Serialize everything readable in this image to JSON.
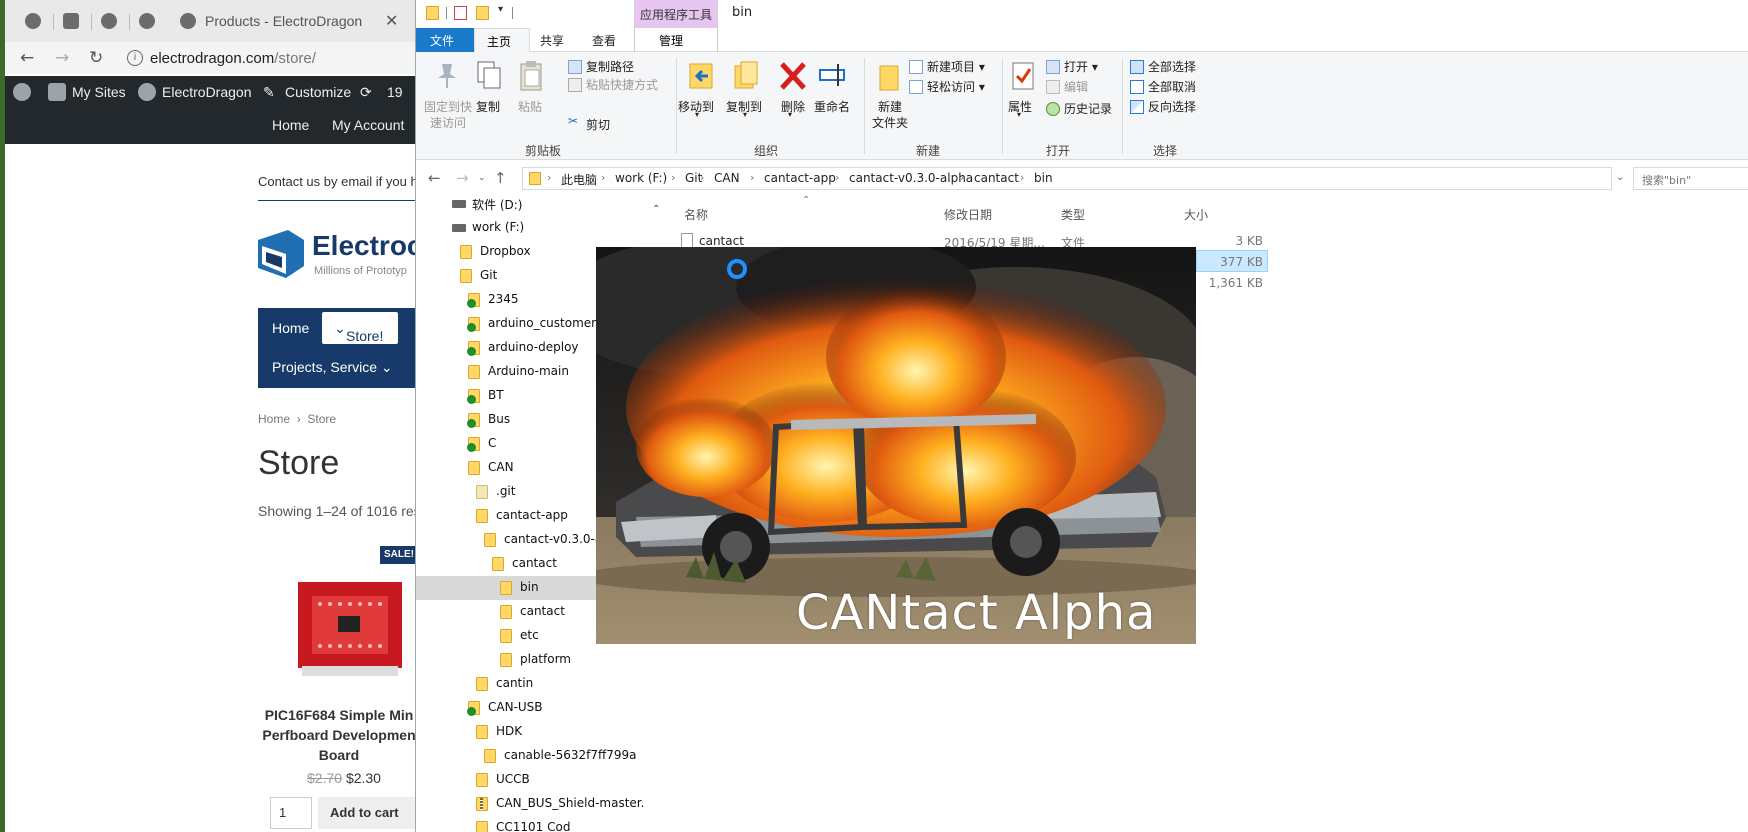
{
  "browser": {
    "tab_title": "Products - ElectroDragon",
    "url_host": "electrodragon.com",
    "url_path": "/store/",
    "wp_bar": {
      "my_sites": "My Sites",
      "site_name": "ElectroDragon",
      "customize": "Customize",
      "updates": "19"
    },
    "site_menu": {
      "home": "Home",
      "my_account": "My Account"
    },
    "contact_text": "Contact us by email if you h",
    "logo": {
      "name": "Electroc",
      "tagline": "Millions of Prototyp"
    },
    "main_menu": {
      "home": "Home",
      "store": "Store!",
      "projects": "Projects, Service"
    },
    "breadcrumb": {
      "home": "Home",
      "sep": "›",
      "current": "Store"
    },
    "page_title": "Store",
    "showing": "Showing 1–24 of 1016 resu",
    "product": {
      "badge": "SALE!",
      "title_line1": "PIC16F684 Simple Min",
      "title_line2": "Perfboard Developmen",
      "title_line3": "Board",
      "old_price": "$2.70",
      "price": "$2.30",
      "qty": "1",
      "add_to_cart": "Add to cart"
    }
  },
  "explorer": {
    "context_tab": "应用程序工具",
    "window_title": "bin",
    "ribbon_tabs": {
      "file": "文件",
      "home": "主页",
      "share": "共享",
      "view": "查看",
      "manage": "管理"
    },
    "ribbon": {
      "pin_line1": "固定到快",
      "pin_line2": "速访问",
      "copy": "复制",
      "paste": "粘贴",
      "copy_path": "复制路径",
      "paste_shortcut": "粘贴快捷方式",
      "cut": "剪切",
      "group_clipboard": "剪贴板",
      "move_to": "移动到",
      "copy_to": "复制到",
      "delete": "删除",
      "rename": "重命名",
      "group_organize": "组织",
      "new_folder_line1": "新建",
      "new_folder_line2": "文件夹",
      "new_item": "新建项目",
      "easy_access": "轻松访问",
      "group_new": "新建",
      "properties": "属性",
      "open": "打开",
      "edit": "编辑",
      "history": "历史记录",
      "group_open": "打开",
      "select_all": "全部选择",
      "select_none": "全部取消",
      "invert_selection": "反向选择",
      "group_select": "选择"
    },
    "address": [
      "此电脑",
      "work (F:)",
      "Git",
      "CAN",
      "cantact-app",
      "cantact-v0.3.0-alpha",
      "cantact",
      "bin"
    ],
    "search_placeholder": "搜索\"bin\"",
    "tree": [
      {
        "label": "软件 (D:)",
        "type": "drive"
      },
      {
        "label": "work (F:)",
        "type": "drive"
      },
      {
        "label": "Dropbox",
        "type": "folder"
      },
      {
        "label": "Git",
        "type": "folder"
      },
      {
        "label": "2345",
        "type": "check"
      },
      {
        "label": "arduino_customer",
        "type": "check"
      },
      {
        "label": "arduino-deploy",
        "type": "check"
      },
      {
        "label": "Arduino-main",
        "type": "folder"
      },
      {
        "label": "BT",
        "type": "check"
      },
      {
        "label": "Bus",
        "type": "check"
      },
      {
        "label": "C",
        "type": "check"
      },
      {
        "label": "CAN",
        "type": "folder"
      },
      {
        "label": ".git",
        "type": "git"
      },
      {
        "label": "cantact-app",
        "type": "folder"
      },
      {
        "label": "cantact-v0.3.0-a",
        "type": "folder"
      },
      {
        "label": "cantact",
        "type": "folder"
      },
      {
        "label": "bin",
        "type": "folder"
      },
      {
        "label": "cantact",
        "type": "folder"
      },
      {
        "label": "etc",
        "type": "folder"
      },
      {
        "label": "platform",
        "type": "folder"
      },
      {
        "label": "cantin",
        "type": "folder"
      },
      {
        "label": "CAN-USB",
        "type": "check"
      },
      {
        "label": "HDK",
        "type": "folder"
      },
      {
        "label": "canable-5632f7ff799a",
        "type": "folder"
      },
      {
        "label": "UCCB",
        "type": "folder"
      },
      {
        "label": "CAN_BUS_Shield-master.",
        "type": "zip"
      },
      {
        "label": "CC1101 Cod",
        "type": "folder"
      }
    ],
    "columns": {
      "name": "名称",
      "date": "修改日期",
      "type": "类型",
      "size": "大小"
    },
    "files": [
      {
        "name": "cantact",
        "date": "2016/5/19 星期...",
        "type": "文件",
        "size": "3 KB"
      },
      {
        "name": "",
        "date": "",
        "type": "",
        "size": "377 KB"
      },
      {
        "name": "",
        "date": "",
        "type": "",
        "size": "1,361 KB"
      }
    ]
  },
  "splash": {
    "text": "CANtact Alpha"
  }
}
